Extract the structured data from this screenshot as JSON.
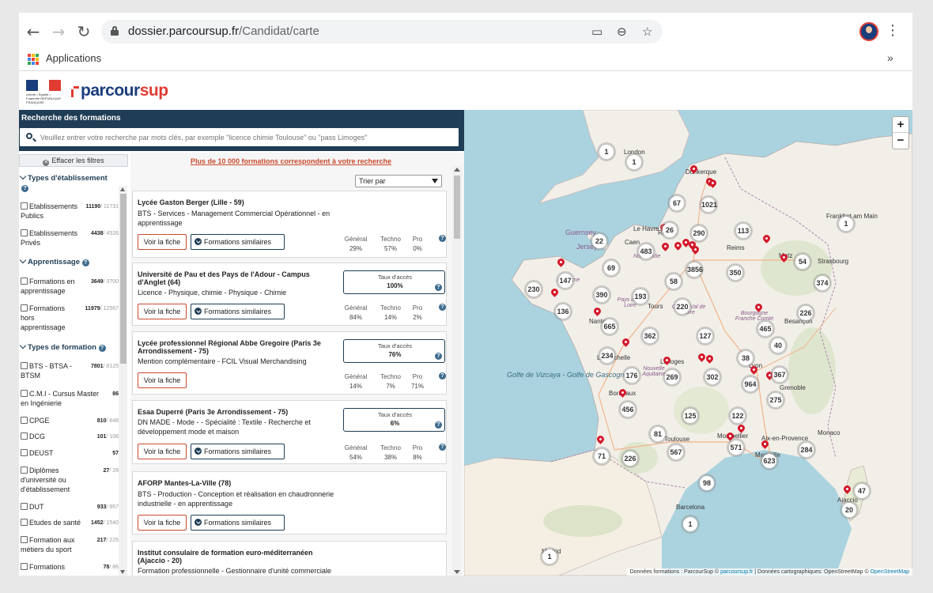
{
  "browser": {
    "url_domain": "dossier.parcoursup.fr",
    "url_path": "/Candidat/carte",
    "bookmark_label": "Applications",
    "more_label": "»"
  },
  "header": {
    "gov_text": "Liberté • Égalité • Fraternité RÉPUBLIQUE FRANÇAISE",
    "logo_part1": "parcour",
    "logo_part2": "sup"
  },
  "search": {
    "title": "Recherche des formations",
    "placeholder": "Veuillez entrer votre recherche par mots clés, par exemple \"licence chimie Toulouse\" ou \"pass Limoges\""
  },
  "filters": {
    "clear_label": "Effacer les filtres",
    "groups": [
      {
        "title": "Types d'établissement"
      },
      {
        "title": "Apprentissage"
      },
      {
        "title": "Types de formation"
      }
    ],
    "items": [
      {
        "label": "Etablissements Publics",
        "count": "11190",
        "total": "/ 11731"
      },
      {
        "label": "Etablissements Privés",
        "count": "4438",
        "total": "/ 4526"
      },
      {
        "label": "Formations en apprentissage",
        "count": "3649",
        "total": "/ 3700"
      },
      {
        "label": "Formations hors apprentissage",
        "count": "11979",
        "total": "/ 12567"
      },
      {
        "label": "BTS - BTSA - BTSM",
        "count": "7801",
        "total": "/ 8125"
      },
      {
        "label": "C.M.I - Cursus Master en Ingénierie",
        "count": "86",
        "total": ""
      },
      {
        "label": "CPGE",
        "count": "810",
        "total": "/ 848"
      },
      {
        "label": "DCG",
        "count": "101",
        "total": "/ 108"
      },
      {
        "label": "DEUST",
        "count": "57",
        "total": ""
      },
      {
        "label": "Diplômes d'université ou d'établissement",
        "count": "27",
        "total": "/ 28"
      },
      {
        "label": "DUT",
        "count": "933",
        "total": "/ 957"
      },
      {
        "label": "Etudes de santé",
        "count": "1452",
        "total": "/ 1540"
      },
      {
        "label": "Formation aux métiers du sport",
        "count": "217",
        "total": "/ 225"
      },
      {
        "label": "Formations",
        "count": "78",
        "total": "/ 86"
      }
    ]
  },
  "results": {
    "count_text": "Plus de 10 000 formations correspondent à votre recherche",
    "sort_label": "Trier par",
    "btn_fiche": "Voir la fiche",
    "btn_similar": "Formations similaires",
    "stat_labels": [
      "Général",
      "Techno",
      "Pro"
    ],
    "access_label": "Taux d'accès",
    "cards": [
      {
        "title": "Lycée Gaston Berger (Lille - 59)",
        "desc": "BTS - Services - Management Commercial Opérationnel - en apprentissage",
        "stats": [
          "29%",
          "57%",
          "0%"
        ]
      },
      {
        "title": "Université de Pau et des Pays de l'Adour - Campus d'Anglet (64)",
        "desc": "Licence - Physique, chimie - Physique - Chimie",
        "access": "100%",
        "stats": [
          "84%",
          "14%",
          "2%"
        ]
      },
      {
        "title": "Lycée professionnel Régional Abbe Gregoire (Paris 3e Arrondissement - 75)",
        "desc": "Mention complémentaire - FCIL Visual Merchandising",
        "access": "76%",
        "stats": [
          "14%",
          "7%",
          "71%"
        ]
      },
      {
        "title": "Esaa Duperré (Paris 3e Arrondissement - 75)",
        "desc": "DN MADE - Mode - - Spécialité : Textile - Recherche et développement mode et maison",
        "access": "6%",
        "stats": [
          "54%",
          "38%",
          "8%"
        ]
      },
      {
        "title": "AFORP Mantes-La-Ville (78)",
        "desc": "BTS - Production - Conception et réalisation en chaudronnerie industrielle - en apprentissage"
      },
      {
        "title": "Institut consulaire de formation euro-méditerranéen (Ajaccio - 20)",
        "desc": "Formation professionnelle - Gestionnaire d'unité commerciale"
      }
    ]
  },
  "map": {
    "zoom_in": "+",
    "zoom_out": "−",
    "clusters": [
      "1",
      "1",
      "67",
      "1021",
      "26",
      "290",
      "113",
      "1",
      "22",
      "483",
      "3856",
      "350",
      "54",
      "69",
      "58",
      "374",
      "230",
      "147",
      "390",
      "193",
      "220",
      "226",
      "136",
      "665",
      "362",
      "127",
      "465",
      "40",
      "234",
      "38",
      "176",
      "269",
      "302",
      "367",
      "964",
      "275",
      "456",
      "125",
      "122",
      "81",
      "571",
      "284",
      "71",
      "226",
      "567",
      "623",
      "47",
      "98",
      "20",
      "1",
      "1"
    ],
    "labels": {
      "london": "London",
      "frankfurt": "Frankfurt am Main",
      "guernsey": "Guernsey",
      "jersey": "Jersey",
      "caen": "Caen",
      "rouen": "Rouen",
      "reims": "Reims",
      "metz": "Metz",
      "strasbourg": "Strasbourg",
      "tours": "Tours",
      "nantes": "Nantes",
      "rochelle": "La Rochelle",
      "limoges": "Limoges",
      "bordeaux": "Bordeaux",
      "lyon": "Lyon",
      "grenoble": "Grenoble",
      "besancon": "Besançon",
      "toulouse": "Toulouse",
      "montpellier": "Montpellier",
      "marseille": "Marseille",
      "aix": "Aix-en-Provence",
      "monaco": "Monaco",
      "barcelona": "Barcelona",
      "madrid": "Madrid",
      "ajaccio": "Ajaccio",
      "dunkerque": "Dunkerque",
      "lehavre": "Le Havre",
      "gulf": "Golfe de Vizcaya - Golfe de Gascogne",
      "bretagne": "Bretagne",
      "normandie": "Normandie",
      "paysdelaloire": "Pays de la Loire",
      "centre": "Centre Val de Loire",
      "bourgogne": "Bourgogne Franche Comté",
      "nouvelle": "Nouvelle Aquitaine"
    },
    "attribution_a": "Données formations : ParcourSup ©",
    "attribution_b": "parcoursup.fr",
    "attribution_c": "| Données cartographiques: OpenStreetMap ©",
    "attribution_d": "OpenStreetMap"
  }
}
